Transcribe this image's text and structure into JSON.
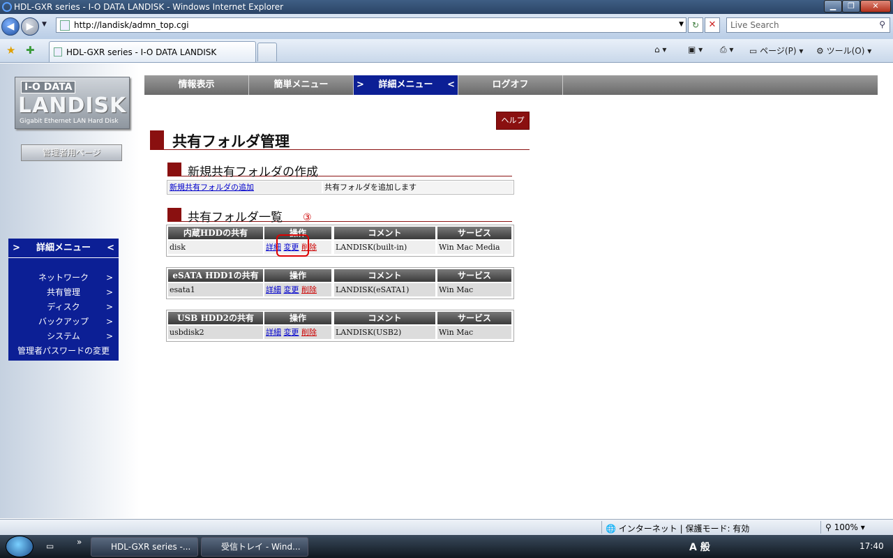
{
  "window": {
    "title": "HDL-GXR series - I-O DATA LANDISK - Windows Internet Explorer",
    "controls": {
      "minimize": "▁",
      "maximize": "❐",
      "close": "✕"
    }
  },
  "browser": {
    "url": "http://landisk/admn_top.cgi",
    "search_placeholder": "Live Search",
    "tab_title": "HDL-GXR series - I-O DATA LANDISK",
    "toolbar": {
      "page": "ページ(P)",
      "tools": "ツール(O)"
    },
    "status": {
      "zone": "インターネット | 保護モード: 有効",
      "zoom": "100%"
    }
  },
  "logo": {
    "brand": "I-O DATA",
    "product": "LANDISK",
    "tagline": "Gigabit Ethernet LAN Hard Disk"
  },
  "admin_page_button": "管理者用ページ",
  "topnav": {
    "items": [
      {
        "label": "情報表示"
      },
      {
        "label": "簡単メニュー"
      },
      {
        "label": "詳細メニュー",
        "active": true
      },
      {
        "label": "ログオフ"
      }
    ],
    "arrow_left": ">",
    "arrow_right": "<"
  },
  "sidemenu": {
    "title": "詳細メニュー",
    "arrow_left": ">",
    "arrow_right": "<",
    "item_arrow": ">",
    "items": [
      "ネットワーク",
      "共有管理",
      "ディスク",
      "バックアップ",
      "システム",
      "管理者パスワードの変更"
    ]
  },
  "help_button": "ヘルプ",
  "page_title": "共有フォルダ管理",
  "new_share": {
    "section_title": "新規共有フォルダの作成",
    "link": "新規共有フォルダの追加",
    "desc": "共有フォルダを追加します"
  },
  "share_list": {
    "section_title": "共有フォルダ一覧",
    "annotation": "③",
    "col_ops": "操作",
    "col_comment": "コメント",
    "col_service": "サービス",
    "op_detail": "詳細",
    "op_change": "変更",
    "op_delete": "削除",
    "tables": [
      {
        "header": "内蔵HDDの共有",
        "name": "disk",
        "comment": "LANDISK(built-in)",
        "service": "Win Mac Media"
      },
      {
        "header": "eSATA HDD1の共有",
        "name": "esata1",
        "comment": "LANDISK(eSATA1)",
        "service": "Win Mac"
      },
      {
        "header": "USB HDD2の共有",
        "name": "usbdisk2",
        "comment": "LANDISK(USB2)",
        "service": "Win Mac"
      }
    ]
  },
  "taskbar": {
    "buttons": [
      "HDL-GXR series -...",
      "受信トレイ - Wind..."
    ],
    "ime": "A 般",
    "clock": "17:40"
  },
  "colors": {
    "accent_red": "#8a1010",
    "menu_blue": "#0c1f95"
  }
}
